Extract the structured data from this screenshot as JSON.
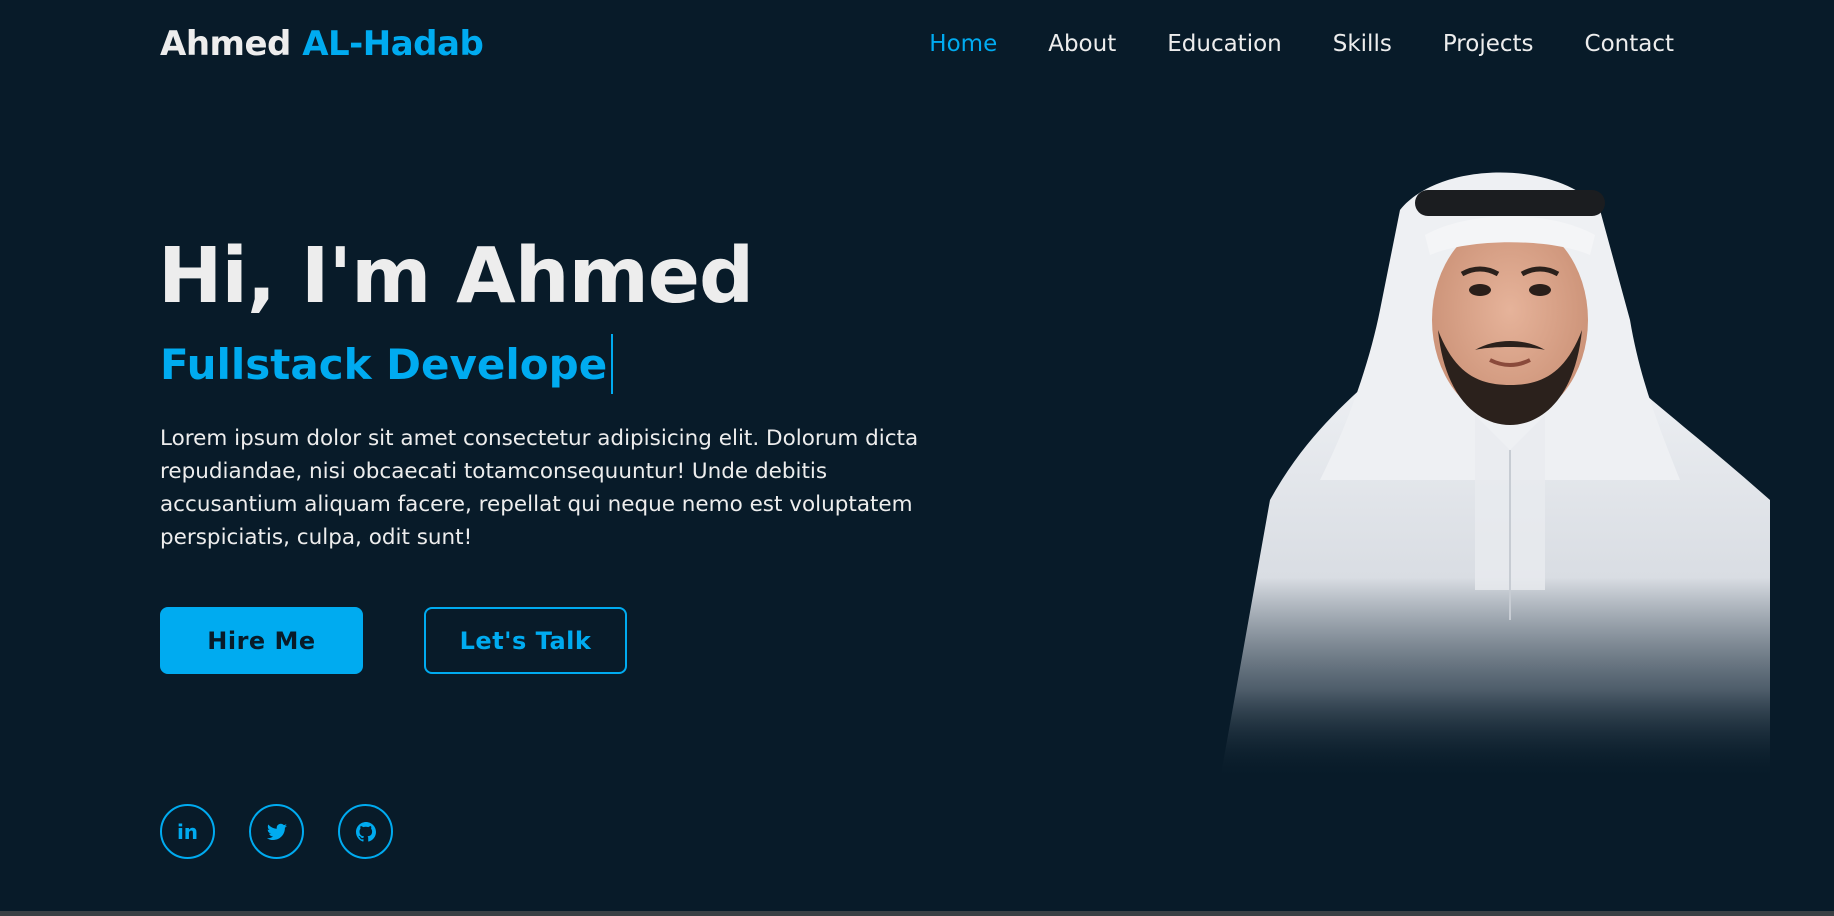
{
  "brand": {
    "first": "Ahmed",
    "last": "AL-Hadab"
  },
  "nav": [
    {
      "label": "Home",
      "active": true
    },
    {
      "label": "About",
      "active": false
    },
    {
      "label": "Education",
      "active": false
    },
    {
      "label": "Skills",
      "active": false
    },
    {
      "label": "Projects",
      "active": false
    },
    {
      "label": "Contact",
      "active": false
    }
  ],
  "hero": {
    "greeting": "Hi, I'm Ahmed",
    "role": "Fullstack Develope",
    "description": "Lorem ipsum dolor sit amet consectetur adipisicing elit. Dolorum dicta repudiandae, nisi obcaecati totamconsequuntur! Unde debitis accusantium aliquam facere, repellat qui neque nemo est voluptatem perspiciatis, culpa, odit sunt!"
  },
  "buttons": {
    "hire": "Hire Me",
    "talk": "Let's Talk"
  },
  "socials": [
    {
      "icon": "linkedin-icon",
      "text": "in"
    },
    {
      "icon": "twitter-icon"
    },
    {
      "icon": "github-icon"
    }
  ],
  "colors": {
    "background": "#081b29",
    "accent": "#00abf0",
    "text": "#ededed"
  }
}
